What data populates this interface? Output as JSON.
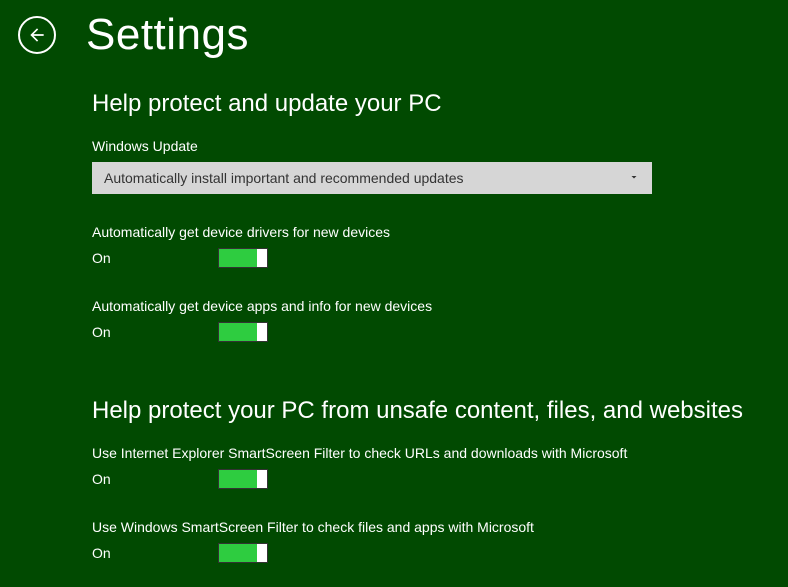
{
  "header": {
    "title": "Settings"
  },
  "sections": {
    "update": {
      "heading": "Help protect and update your PC",
      "windows_update_label": "Windows Update",
      "windows_update_selected": "Automatically install important and recommended updates",
      "drivers_label": "Automatically get device drivers for new devices",
      "drivers_state": "On",
      "apps_label": "Automatically get device apps and info for new devices",
      "apps_state": "On"
    },
    "protect": {
      "heading": "Help protect your PC from unsafe content, files, and websites",
      "ie_smartscreen_label": "Use Internet Explorer SmartScreen Filter to check URLs and downloads with Microsoft",
      "ie_smartscreen_state": "On",
      "win_smartscreen_label": "Use Windows SmartScreen Filter to check files and apps with Microsoft",
      "win_smartscreen_state": "On"
    }
  }
}
